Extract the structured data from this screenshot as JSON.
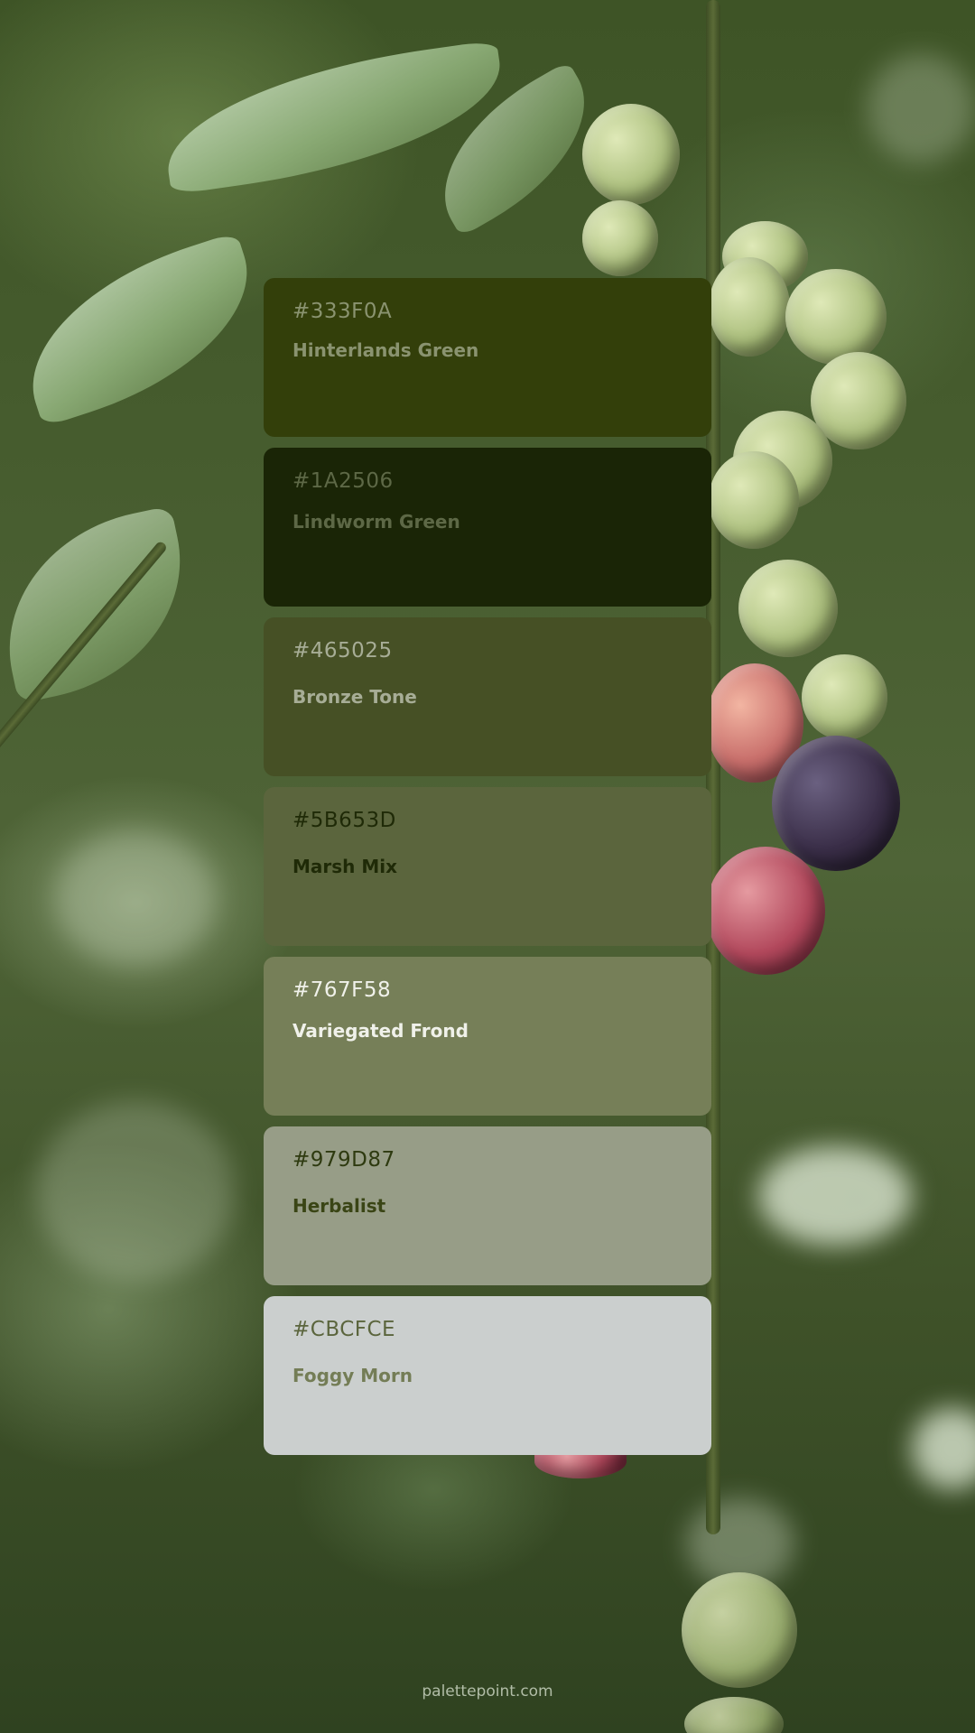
{
  "swatches": [
    {
      "hex": "#333F0A",
      "name": "Hinterlands Green",
      "bg": "#333F0A",
      "hex_color": "#8a9370",
      "name_color": "#8a9370",
      "name_size": 42
    },
    {
      "hex": "#1A2506",
      "name": "Lindworm Green",
      "bg": "#1A2506",
      "hex_color": "#5d6846",
      "name_color": "#5d6846",
      "name_size": 46
    },
    {
      "hex": "#465025",
      "name": "Bronze Tone",
      "bg": "#465025",
      "hex_color": "#a7ad96",
      "name_color": "#a7ad96",
      "name_size": 58
    },
    {
      "hex": "#5B653D",
      "name": "Marsh Mix",
      "bg": "#5B653D",
      "hex_color": "#1f2a07",
      "name_color": "#1f2a07",
      "name_size": 58
    },
    {
      "hex": "#767F58",
      "name": "Variegated Frond",
      "bg": "#767F58",
      "hex_color": "#f0f1ea",
      "name_color": "#f0f1ea",
      "name_size": 46
    },
    {
      "hex": "#979D87",
      "name": "Herbalist",
      "bg": "#979D87",
      "hex_color": "#2e3a10",
      "name_color": "#3a4515",
      "name_size": 58
    },
    {
      "hex": "#CBCFCE",
      "name": "Foggy Morn",
      "bg": "#CBCFCE",
      "hex_color": "#5b653d",
      "name_color": "#747d56",
      "name_size": 58
    }
  ],
  "footer": {
    "text": "palettepoint.com"
  }
}
